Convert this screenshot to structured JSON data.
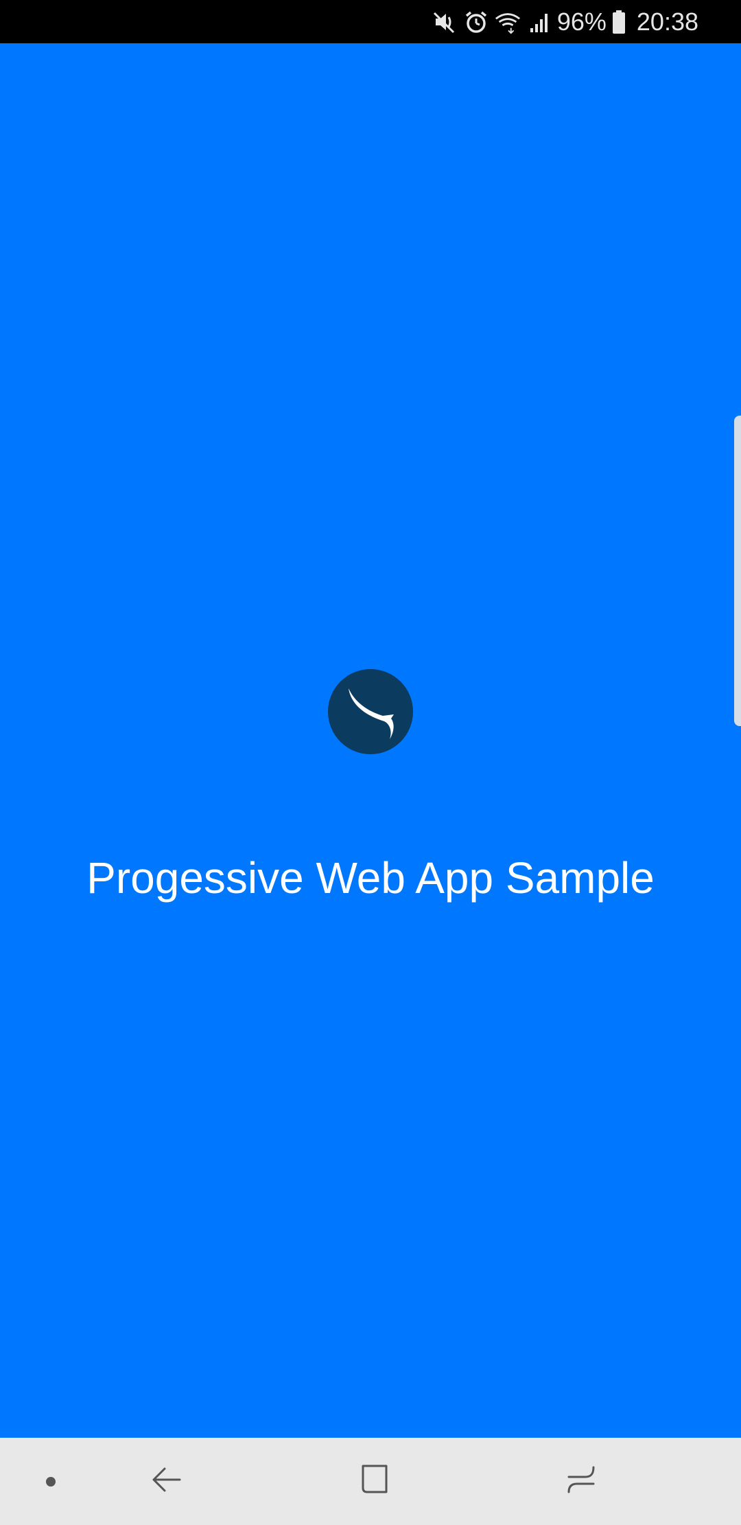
{
  "status_bar": {
    "battery_text": "96%",
    "clock": "20:38",
    "icons": [
      "mute-icon",
      "alarm-icon",
      "wifi-icon",
      "signal-icon",
      "battery-icon"
    ]
  },
  "splash": {
    "app_name": "Progessive Web App Sample",
    "logo_icon": "swoosh-logo-icon",
    "background_color": "#0077ff",
    "logo_color": "#0b3b5e"
  },
  "nav_bar": {
    "icons": [
      "dot-icon",
      "back-icon",
      "home-icon",
      "recents-icon"
    ]
  }
}
